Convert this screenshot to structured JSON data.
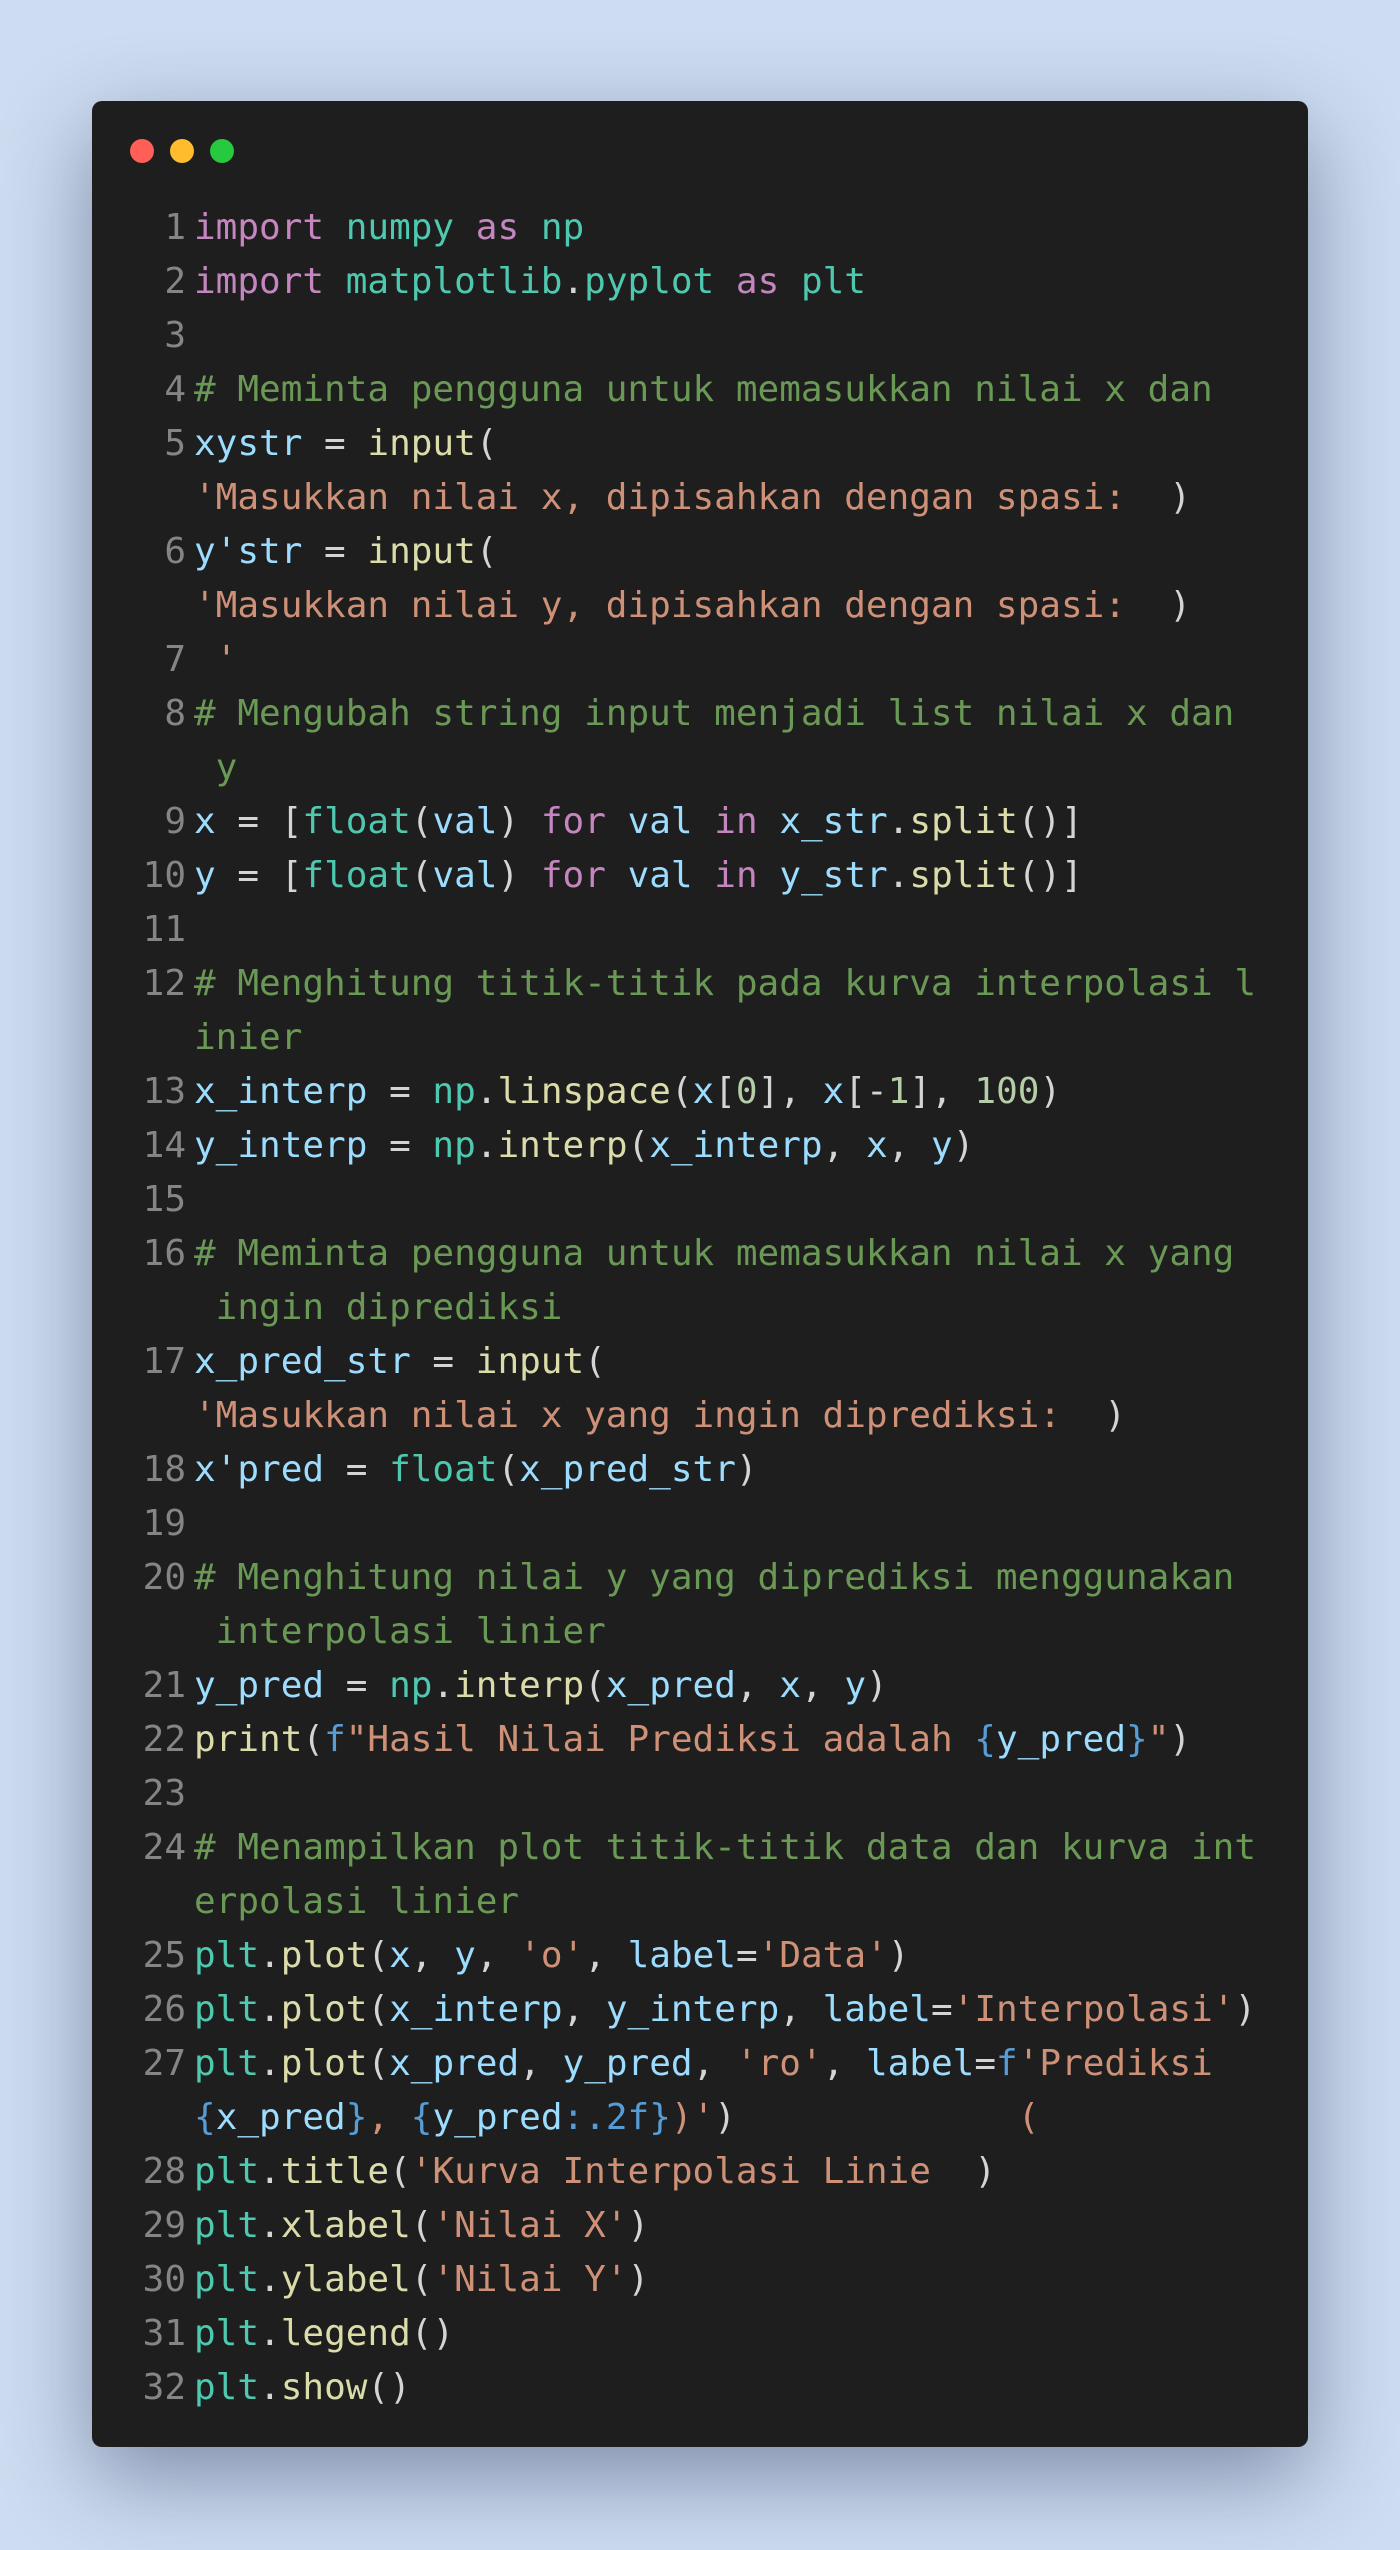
{
  "window": {
    "dot_colors": [
      "#ff5f56",
      "#ffbd2e",
      "#27c93f"
    ]
  },
  "lines": [
    {
      "n": "1",
      "t": [
        [
          "kw",
          "import"
        ],
        [
          "pun",
          " "
        ],
        [
          "mod",
          "numpy"
        ],
        [
          "pun",
          " "
        ],
        [
          "kw",
          "as"
        ],
        [
          "pun",
          " "
        ],
        [
          "mod",
          "np"
        ]
      ]
    },
    {
      "n": "2",
      "t": [
        [
          "kw",
          "import"
        ],
        [
          "pun",
          " "
        ],
        [
          "mod",
          "matplotlib"
        ],
        [
          "pun",
          "."
        ],
        [
          "mod",
          "pyplot"
        ],
        [
          "pun",
          " "
        ],
        [
          "kw",
          "as"
        ],
        [
          "pun",
          " "
        ],
        [
          "mod",
          "plt"
        ]
      ]
    },
    {
      "n": "3",
      "t": []
    },
    {
      "n": "4",
      "t": [
        [
          "cm",
          "# Meminta pengguna untuk memasukkan nilai x dan"
        ]
      ]
    },
    {
      "n": "5",
      "t": [
        [
          "var",
          "xystr"
        ],
        [
          "pun",
          " = "
        ],
        [
          "fn",
          "input"
        ],
        [
          "pun",
          "("
        ]
      ]
    },
    {
      "n": "",
      "t": [
        [
          "str",
          "'Masukkan nilai x, dipisahkan dengan spasi:  "
        ],
        [
          "pun",
          ")"
        ]
      ]
    },
    {
      "n": "6",
      "t": [
        [
          "var",
          "y'str"
        ],
        [
          "pun",
          " = "
        ],
        [
          "fn",
          "input"
        ],
        [
          "pun",
          "("
        ]
      ]
    },
    {
      "n": "",
      "t": [
        [
          "str",
          "'Masukkan nilai y, dipisahkan dengan spasi:  "
        ],
        [
          "pun",
          ")"
        ]
      ]
    },
    {
      "n": "7",
      "t": [
        [
          "str",
          " '"
        ]
      ]
    },
    {
      "n": "8",
      "t": [
        [
          "cm",
          "# Mengubah string input menjadi list nilai x dan"
        ]
      ]
    },
    {
      "n": "",
      "t": [
        [
          "cm",
          " y"
        ]
      ]
    },
    {
      "n": "9",
      "t": [
        [
          "var",
          "x"
        ],
        [
          "pun",
          " = ["
        ],
        [
          "mod",
          "float"
        ],
        [
          "pun",
          "("
        ],
        [
          "var",
          "val"
        ],
        [
          "pun",
          ") "
        ],
        [
          "kw",
          "for"
        ],
        [
          "pun",
          " "
        ],
        [
          "var",
          "val"
        ],
        [
          "pun",
          " "
        ],
        [
          "kw",
          "in"
        ],
        [
          "pun",
          " "
        ],
        [
          "var",
          "x_str"
        ],
        [
          "pun",
          "."
        ],
        [
          "fn",
          "split"
        ],
        [
          "pun",
          "()]"
        ]
      ]
    },
    {
      "n": "10",
      "t": [
        [
          "var",
          "y"
        ],
        [
          "pun",
          " = ["
        ],
        [
          "mod",
          "float"
        ],
        [
          "pun",
          "("
        ],
        [
          "var",
          "val"
        ],
        [
          "pun",
          ") "
        ],
        [
          "kw",
          "for"
        ],
        [
          "pun",
          " "
        ],
        [
          "var",
          "val"
        ],
        [
          "pun",
          " "
        ],
        [
          "kw",
          "in"
        ],
        [
          "pun",
          " "
        ],
        [
          "var",
          "y_str"
        ],
        [
          "pun",
          "."
        ],
        [
          "fn",
          "split"
        ],
        [
          "pun",
          "()]"
        ]
      ]
    },
    {
      "n": "11",
      "t": []
    },
    {
      "n": "12",
      "t": [
        [
          "cm",
          "# Menghitung titik-titik pada kurva interpolasi l"
        ]
      ]
    },
    {
      "n": "",
      "t": [
        [
          "cm",
          "inier"
        ]
      ]
    },
    {
      "n": "13",
      "t": [
        [
          "var",
          "x_interp"
        ],
        [
          "pun",
          " = "
        ],
        [
          "mod",
          "np"
        ],
        [
          "pun",
          "."
        ],
        [
          "fn",
          "linspace"
        ],
        [
          "pun",
          "("
        ],
        [
          "var",
          "x"
        ],
        [
          "pun",
          "["
        ],
        [
          "num",
          "0"
        ],
        [
          "pun",
          "], "
        ],
        [
          "var",
          "x"
        ],
        [
          "pun",
          "[-"
        ],
        [
          "num",
          "1"
        ],
        [
          "pun",
          "], "
        ],
        [
          "num",
          "100"
        ],
        [
          "pun",
          ")"
        ]
      ]
    },
    {
      "n": "14",
      "t": [
        [
          "var",
          "y_interp"
        ],
        [
          "pun",
          " = "
        ],
        [
          "mod",
          "np"
        ],
        [
          "pun",
          "."
        ],
        [
          "fn",
          "interp"
        ],
        [
          "pun",
          "("
        ],
        [
          "var",
          "x_interp"
        ],
        [
          "pun",
          ", "
        ],
        [
          "var",
          "x"
        ],
        [
          "pun",
          ", "
        ],
        [
          "var",
          "y"
        ],
        [
          "pun",
          ")"
        ]
      ]
    },
    {
      "n": "15",
      "t": []
    },
    {
      "n": "16",
      "t": [
        [
          "cm",
          "# Meminta pengguna untuk memasukkan nilai x yang"
        ]
      ]
    },
    {
      "n": "",
      "t": [
        [
          "cm",
          " ingin diprediksi"
        ]
      ]
    },
    {
      "n": "17",
      "t": [
        [
          "var",
          "x_pred_str"
        ],
        [
          "pun",
          " = "
        ],
        [
          "fn",
          "input"
        ],
        [
          "pun",
          "("
        ]
      ]
    },
    {
      "n": "",
      "t": [
        [
          "str",
          "'Masukkan nilai x yang ingin diprediksi:  "
        ],
        [
          "pun",
          ")"
        ]
      ]
    },
    {
      "n": "18",
      "t": [
        [
          "var",
          "x'pred"
        ],
        [
          "pun",
          " = "
        ],
        [
          "mod",
          "float"
        ],
        [
          "pun",
          "("
        ],
        [
          "var",
          "x_pred_str"
        ],
        [
          "pun",
          ")"
        ]
      ]
    },
    {
      "n": "19",
      "t": []
    },
    {
      "n": "20",
      "t": [
        [
          "cm",
          "# Menghitung nilai y yang diprediksi menggunakan"
        ]
      ]
    },
    {
      "n": "",
      "t": [
        [
          "cm",
          " interpolasi linier"
        ]
      ]
    },
    {
      "n": "21",
      "t": [
        [
          "var",
          "y_pred"
        ],
        [
          "pun",
          " = "
        ],
        [
          "mod",
          "np"
        ],
        [
          "pun",
          "."
        ],
        [
          "fn",
          "interp"
        ],
        [
          "pun",
          "("
        ],
        [
          "var",
          "x_pred"
        ],
        [
          "pun",
          ", "
        ],
        [
          "var",
          "x"
        ],
        [
          "pun",
          ", "
        ],
        [
          "var",
          "y"
        ],
        [
          "pun",
          ")"
        ]
      ]
    },
    {
      "n": "22",
      "t": [
        [
          "fn",
          "print"
        ],
        [
          "pun",
          "("
        ],
        [
          "fk",
          "f"
        ],
        [
          "str",
          "\"Hasil Nilai Prediksi adalah "
        ],
        [
          "fk",
          "{"
        ],
        [
          "var",
          "y_pred"
        ],
        [
          "fk",
          "}"
        ],
        [
          "str",
          "\""
        ],
        [
          "pun",
          ")"
        ]
      ]
    },
    {
      "n": "23",
      "t": []
    },
    {
      "n": "24",
      "t": [
        [
          "cm",
          "# Menampilkan plot titik-titik data dan kurva int"
        ]
      ]
    },
    {
      "n": "",
      "t": [
        [
          "cm",
          "erpolasi linier"
        ]
      ]
    },
    {
      "n": "25",
      "t": [
        [
          "mod",
          "plt"
        ],
        [
          "pun",
          "."
        ],
        [
          "fn",
          "plot"
        ],
        [
          "pun",
          "("
        ],
        [
          "var",
          "x"
        ],
        [
          "pun",
          ", "
        ],
        [
          "var",
          "y"
        ],
        [
          "pun",
          ", "
        ],
        [
          "str",
          "'o'"
        ],
        [
          "pun",
          ", "
        ],
        [
          "var",
          "label"
        ],
        [
          "pun",
          "="
        ],
        [
          "str",
          "'Data'"
        ],
        [
          "pun",
          ")"
        ]
      ]
    },
    {
      "n": "26",
      "t": [
        [
          "mod",
          "plt"
        ],
        [
          "pun",
          "."
        ],
        [
          "fn",
          "plot"
        ],
        [
          "pun",
          "("
        ],
        [
          "var",
          "x_interp"
        ],
        [
          "pun",
          ", "
        ],
        [
          "var",
          "y_interp"
        ],
        [
          "pun",
          ", "
        ],
        [
          "var",
          "label"
        ],
        [
          "pun",
          "="
        ],
        [
          "str",
          "'Interpolasi'"
        ],
        [
          "pun",
          ")"
        ]
      ]
    },
    {
      "n": "27",
      "t": [
        [
          "mod",
          "plt"
        ],
        [
          "pun",
          "."
        ],
        [
          "fn",
          "plot"
        ],
        [
          "pun",
          "("
        ],
        [
          "var",
          "x_pred"
        ],
        [
          "pun",
          ", "
        ],
        [
          "var",
          "y_pred"
        ],
        [
          "pun",
          ", "
        ],
        [
          "str",
          "'ro'"
        ],
        [
          "pun",
          ", "
        ],
        [
          "var",
          "label"
        ],
        [
          "pun",
          "="
        ],
        [
          "fk",
          "f"
        ],
        [
          "str",
          "'Prediksi"
        ]
      ]
    },
    {
      "n": "",
      "t": [
        [
          "fk",
          "{"
        ],
        [
          "var",
          "x_pred"
        ],
        [
          "fk",
          "}"
        ],
        [
          "str",
          ", "
        ],
        [
          "fk",
          "{"
        ],
        [
          "var",
          "y_pred"
        ],
        [
          "fk",
          ":.2f}"
        ],
        [
          "str",
          ")'"
        ],
        [
          "pun",
          ")"
        ],
        [
          "pun",
          "             "
        ],
        [
          "str",
          "("
        ]
      ]
    },
    {
      "n": "28",
      "t": [
        [
          "mod",
          "plt"
        ],
        [
          "pun",
          "."
        ],
        [
          "fn",
          "title"
        ],
        [
          "pun",
          "("
        ],
        [
          "str",
          "'Kurva Interpolasi Linie  "
        ],
        [
          "pun",
          ")"
        ]
      ]
    },
    {
      "n": "29",
      "t": [
        [
          "mod",
          "plt"
        ],
        [
          "pun",
          "."
        ],
        [
          "fn",
          "xlabel"
        ],
        [
          "pun",
          "("
        ],
        [
          "str",
          "'Nilai X'"
        ],
        [
          "pun",
          ")"
        ]
      ]
    },
    {
      "n": "30",
      "t": [
        [
          "mod",
          "plt"
        ],
        [
          "pun",
          "."
        ],
        [
          "fn",
          "ylabel"
        ],
        [
          "pun",
          "("
        ],
        [
          "str",
          "'Nilai Y'"
        ],
        [
          "pun",
          ")"
        ]
      ]
    },
    {
      "n": "31",
      "t": [
        [
          "mod",
          "plt"
        ],
        [
          "pun",
          "."
        ],
        [
          "fn",
          "legend"
        ],
        [
          "pun",
          "()"
        ]
      ]
    },
    {
      "n": "32",
      "t": [
        [
          "mod",
          "plt"
        ],
        [
          "pun",
          "."
        ],
        [
          "fn",
          "show"
        ],
        [
          "pun",
          "()"
        ]
      ]
    }
  ]
}
